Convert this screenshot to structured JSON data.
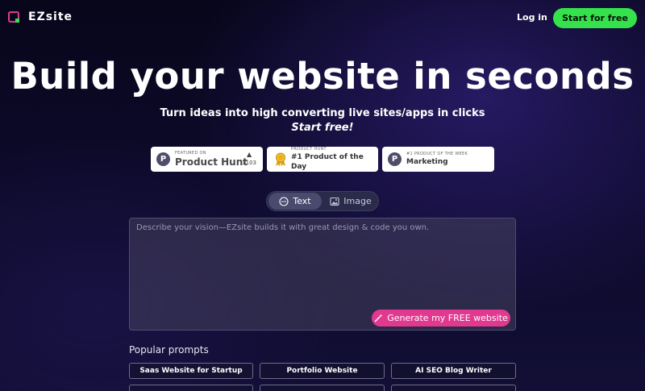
{
  "header": {
    "brand": "EZsite",
    "login_label": "Log in",
    "start_label": "Start for free"
  },
  "hero": {
    "title": "Build your website in seconds",
    "subtitle": "Turn ideas into high converting live sites/apps in clicks",
    "tagline": "Start free!"
  },
  "badges": [
    {
      "icon": "product-hunt-icon",
      "small": "FEATURED ON",
      "big": "Product Hunt",
      "votes": "1103",
      "vote_glyph": "▲"
    },
    {
      "icon": "medal-icon",
      "small": "PRODUCT HUNT",
      "big": "#1 Product of the Day"
    },
    {
      "icon": "product-hunt-icon",
      "small": "#1 PRODUCT OF THE WEEK",
      "big": "Marketing"
    }
  ],
  "mode": {
    "tabs": [
      {
        "label": "Text",
        "icon": "chat-icon",
        "active": true
      },
      {
        "label": "Image",
        "icon": "image-icon",
        "active": false
      }
    ]
  },
  "prompt": {
    "placeholder": "Describe your vision—EZsite builds it with great design & code you own.",
    "generate_label": "Generate my FREE website"
  },
  "popular": {
    "label": "Popular prompts",
    "chips": [
      "Saas Website for Startup",
      "Portfolio Website",
      "AI SEO Blog Writer"
    ]
  },
  "colors": {
    "accent_green": "#35e24c",
    "accent_pink": "#e1398f"
  }
}
